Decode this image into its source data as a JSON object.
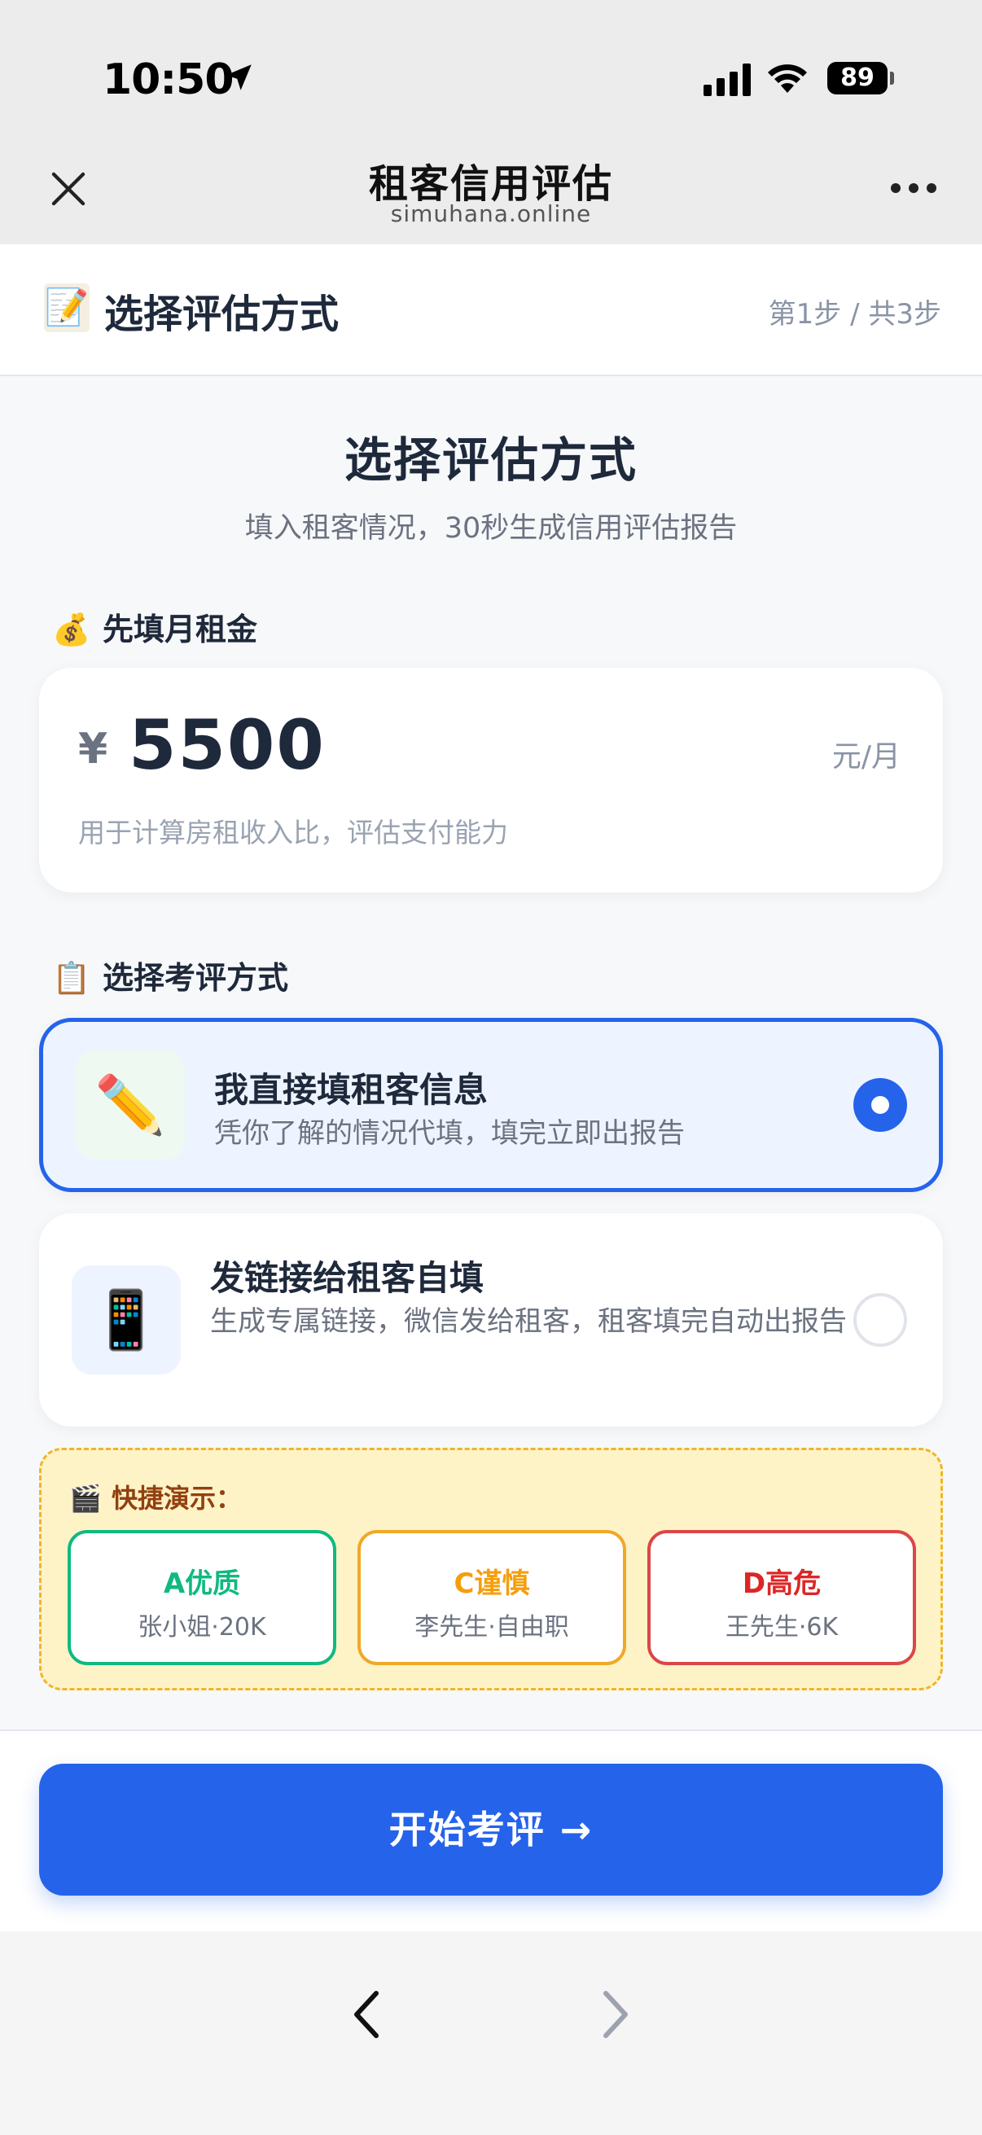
{
  "status_bar": {
    "time": "10:50",
    "battery": "89"
  },
  "browser": {
    "title": "租客信用评估",
    "url": "simuhana.online"
  },
  "page_header": {
    "emoji": "📝",
    "title": "选择评估方式",
    "step": "第1步 / 共3步"
  },
  "hero": {
    "title": "选择评估方式",
    "subtitle": "填入租客情况，30秒生成信用评估报告"
  },
  "rent_section": {
    "emoji": "💰",
    "label": "先填月租金",
    "currency": "¥",
    "value": "5500",
    "unit": "元/月",
    "hint": "用于计算房租收入比，评估支付能力"
  },
  "method_section": {
    "emoji": "📋",
    "label": "选择考评方式",
    "options": [
      {
        "emoji": "✏️",
        "title": "我直接填租客信息",
        "desc": "凭你了解的情况代填，填完立即出报告",
        "selected": true
      },
      {
        "emoji": "📱",
        "title": "发链接给租客自填",
        "desc": "生成专属链接，微信发给租客，租客填完自动出报告",
        "selected": false
      }
    ]
  },
  "demo": {
    "emoji": "🎬",
    "label": "快捷演示：",
    "items": [
      {
        "grade": "A优质",
        "name": "张小姐·20K",
        "color": "#10b981"
      },
      {
        "grade": "C谨慎",
        "name": "李先生·自由职",
        "color": "#f59e0b"
      },
      {
        "grade": "D高危",
        "name": "王先生·6K",
        "color": "#dc2626"
      }
    ]
  },
  "start_button": "开始考评 →",
  "colors": {
    "primary": "#2563eb",
    "demo_bg": "#fef3c7",
    "demo_border": "#f0b429"
  }
}
